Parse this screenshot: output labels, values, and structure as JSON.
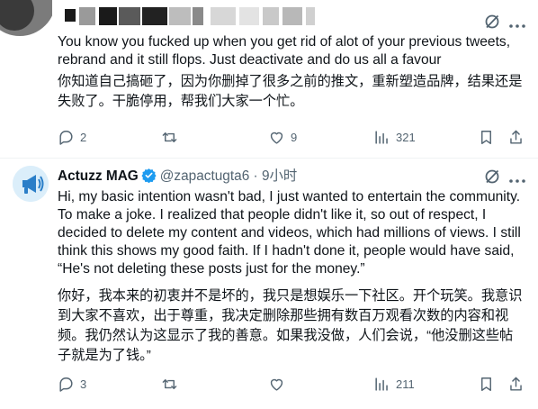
{
  "tweet1": {
    "body": "You know you fucked up when you get rid of alot of your previous tweets, rebrand and it still flops. Just deactivate and do us all a favour",
    "translation": "你知道自己搞砸了，因为你删掉了很多之前的推文，重新塑造品牌，结果还是失败了。干脆停用，帮我们大家一个忙。",
    "stats": {
      "replies": "2",
      "reposts": "",
      "likes": "9",
      "views": "321"
    }
  },
  "tweet2": {
    "author_name": "Actuzz MAG",
    "handle": "@zapactugta6",
    "time": "· 9小时",
    "body": "Hi, my basic intention wasn't bad, I just wanted to entertain the community. To make a joke. I realized that people didn't like it, so out of respect, I decided to delete my content and videos, which had millions of views. I still think this shows my good faith. If I hadn't done it, people would have said, “He's not deleting these posts just for the money.”",
    "translation": "你好，我本来的初衷并不是坏的，我只是想娱乐一下社区。开个玩笑。我意识到大家不喜欢，出于尊重，我决定删除那些拥有数百万观看次数的内容和视频。我仍然认为这显示了我的善意。如果我没做，人们会说，“他没删这些帖子就是为了钱。”",
    "stats": {
      "replies": "3",
      "reposts": "",
      "likes": "",
      "views": "211"
    }
  },
  "icons": {
    "grok": "grok-icon",
    "more": "more-icon",
    "reply": "reply-icon",
    "repost": "repost-icon",
    "like": "heart-icon",
    "views": "views-icon",
    "bookmark": "bookmark-icon",
    "share": "share-icon",
    "verified": "verified-badge-icon"
  },
  "colors": {
    "text": "#0f1419",
    "secondary": "#536471",
    "verified": "#1d9bf0"
  }
}
